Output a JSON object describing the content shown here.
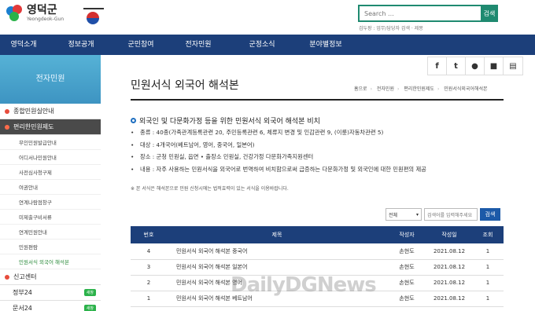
{
  "header": {
    "logo_ko": "영덕군",
    "logo_en": "Yeongdeok-Gun",
    "search_placeholder": "Search ...",
    "search_button": "검색",
    "search_hint": "검두팡 : 업무/담당자 검색 · 제몽"
  },
  "nav": {
    "items": [
      "영덕소개",
      "정보공개",
      "군민참여",
      "전자민원",
      "군정소식",
      "분야별정보"
    ]
  },
  "sidebar": {
    "title": "전자민원",
    "sections": [
      {
        "label": "종합민원실안내"
      },
      {
        "label": "편리한민원제도"
      }
    ],
    "sub_items": [
      "무인민원발급안내",
      "어디서나민원안내",
      "사전심사청구제",
      "여권안내",
      "연계나람점창구",
      "미제출구비서류",
      "연계민원안내",
      "민원편람",
      "민원서식 외국어 해석본"
    ],
    "report_center": "신고센터",
    "external": [
      {
        "label": "정부24",
        "badge": "새창"
      },
      {
        "label": "문서24",
        "badge": "새창"
      }
    ]
  },
  "social": {
    "icons": [
      "facebook-icon",
      "twitter-icon",
      "speech-bubble-icon",
      "bookmark-icon",
      "print-icon"
    ],
    "glyphs": [
      "f",
      "t",
      "●",
      "■",
      "▤"
    ]
  },
  "main": {
    "title": "민원서식 외국어 해석본",
    "breadcrumb": [
      "홈으로",
      "전자민원",
      "편리한민원제도",
      "민원서식외국어해석본"
    ],
    "info_title": "외국인 및 다문화가정 등을 위한 민원서식 외국어 해석본 비치",
    "info_items": [
      "종류 : 40종(가족관계등록관련 20, 주민등록관련 6, 체류지 변경 및 인감관련 9, (이륜)자동차관련 5)",
      "대상 : 4개국어(베트남어, 영어, 중국어, 일본어)",
      "장소 : 군청 민원실, 읍면 • 출장소 민원실, 건강가정 다문화가족지원센터",
      "내용 : 자주 사용하는 민원서식을 외국어로 번역하여 비치함으로써 급증하는 다문화가정 및 외국인에 대한 민원편의 제공"
    ],
    "note": "※ 본 서식은 해석본으로 민원 신청시에는 법적효력이 있는 서식을 이용바랍니다.",
    "filter": {
      "select_value": "전체",
      "input_placeholder": "검색어를 입력해주세요",
      "button": "검색"
    },
    "table": {
      "headers": [
        "번호",
        "제목",
        "작성자",
        "작성일",
        "조회"
      ],
      "rows": [
        {
          "no": "4",
          "title": "민원서식 외국어 해석본 중국어",
          "author": "손현도",
          "date": "2021.08.12",
          "views": "1"
        },
        {
          "no": "3",
          "title": "민원서식 외국어 해석본 일본어",
          "author": "손현도",
          "date": "2021.08.12",
          "views": "1"
        },
        {
          "no": "2",
          "title": "민원서식 외국어 해석본 영어",
          "author": "손현도",
          "date": "2021.08.12",
          "views": "1"
        },
        {
          "no": "1",
          "title": "민원서식 외국어 해석본 베트남어",
          "author": "손현도",
          "date": "2021.08.12",
          "views": "1"
        }
      ]
    }
  },
  "watermark": "DailyDGNews"
}
